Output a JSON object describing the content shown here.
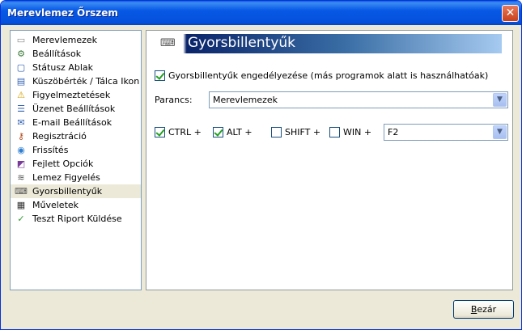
{
  "window": {
    "title": "Merevlemez Őrszem",
    "close_glyph": "✕"
  },
  "sidebar": {
    "items": [
      {
        "label": "Merevlemezek",
        "icon": "hard-drive-icon",
        "glyph": "▭",
        "color": "#8a8a8a"
      },
      {
        "label": "Beállítások",
        "icon": "settings-icon",
        "glyph": "⚙",
        "color": "#3d7a3d"
      },
      {
        "label": "Státusz Ablak",
        "icon": "window-icon",
        "glyph": "▢",
        "color": "#2f5fb3"
      },
      {
        "label": "Küszöbérték / Tálca Ikon",
        "icon": "tray-icon",
        "glyph": "▤",
        "color": "#2f5fb3"
      },
      {
        "label": "Figyelmeztetések",
        "icon": "warning-icon",
        "glyph": "⚠",
        "color": "#d4a000"
      },
      {
        "label": "Üzenet Beállítások",
        "icon": "message-icon",
        "glyph": "☰",
        "color": "#2f5fb3"
      },
      {
        "label": "E-mail Beállítások",
        "icon": "email-icon",
        "glyph": "✉",
        "color": "#2f5fb3"
      },
      {
        "label": "Regisztráció",
        "icon": "key-icon",
        "glyph": "⚷",
        "color": "#b04a1a"
      },
      {
        "label": "Frissítés",
        "icon": "globe-icon",
        "glyph": "◉",
        "color": "#2f7fd0"
      },
      {
        "label": "Fejlett Opciók",
        "icon": "advanced-icon",
        "glyph": "◩",
        "color": "#7a3a9a"
      },
      {
        "label": "Lemez Figyelés",
        "icon": "monitor-icon",
        "glyph": "≋",
        "color": "#555"
      },
      {
        "label": "Gyorsbillentyűk",
        "icon": "keyboard-icon",
        "glyph": "⌨",
        "color": "#555",
        "selected": true
      },
      {
        "label": "Műveletek",
        "icon": "clapper-icon",
        "glyph": "▦",
        "color": "#333"
      },
      {
        "label": "Teszt Riport Küldése",
        "icon": "report-icon",
        "glyph": "✓",
        "color": "#2f9a2f"
      }
    ]
  },
  "panel": {
    "title": "Gyorsbillentyűk",
    "header_icon": "keyboard-icon",
    "enable_hotkeys": {
      "label": "Gyorsbillentyűk engedélyezése (más programok alatt is használhatóak)",
      "checked": true
    },
    "command": {
      "label": "Parancs:",
      "value": "Merevlemezek"
    },
    "modifiers": [
      {
        "label": "CTRL +",
        "checked": true
      },
      {
        "label": "ALT +",
        "checked": true
      },
      {
        "label": "SHIFT +",
        "checked": false
      },
      {
        "label": "WIN +",
        "checked": false
      }
    ],
    "key": {
      "value": "F2"
    }
  },
  "footer": {
    "close_button": {
      "label_underlined": "B",
      "label_rest": "ezár"
    }
  },
  "colors": {
    "titlebar": "#0758e5",
    "window_bg": "#ece9d8",
    "banner_dark": "#0a246a",
    "check_green": "#21a121"
  }
}
